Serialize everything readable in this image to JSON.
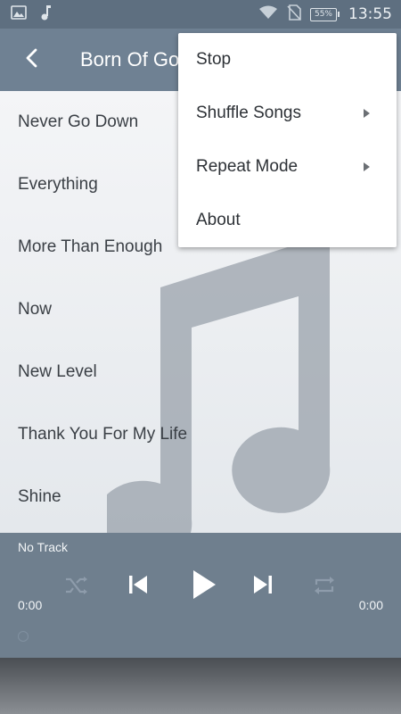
{
  "status_bar": {
    "time": "13:55",
    "battery_level": "55%",
    "icons": [
      "image-icon",
      "music-note-icon",
      "wifi-icon",
      "no-sim-icon",
      "battery-icon"
    ]
  },
  "toolbar": {
    "title": "Born Of God",
    "back_icon": "back-arrow-icon"
  },
  "songs": [
    "Never Go Down",
    "Everything",
    "More Than Enough",
    "Now",
    "New Level",
    "Thank You For My Life",
    "Shine"
  ],
  "player": {
    "track_name": "No Track",
    "elapsed": "0:00",
    "duration": "0:00",
    "controls": [
      "shuffle-icon",
      "previous-icon",
      "play-icon",
      "next-icon",
      "repeat-icon"
    ]
  },
  "menu": {
    "items": [
      {
        "label": "Stop",
        "has_submenu": false
      },
      {
        "label": "Shuffle Songs",
        "has_submenu": true
      },
      {
        "label": "Repeat Mode",
        "has_submenu": true
      },
      {
        "label": "About",
        "has_submenu": false
      }
    ]
  },
  "colors": {
    "status_bar": "#5e6f80",
    "toolbar": "#6f8193",
    "player": "#6f7f8e",
    "menu_background": "#ffffff"
  }
}
